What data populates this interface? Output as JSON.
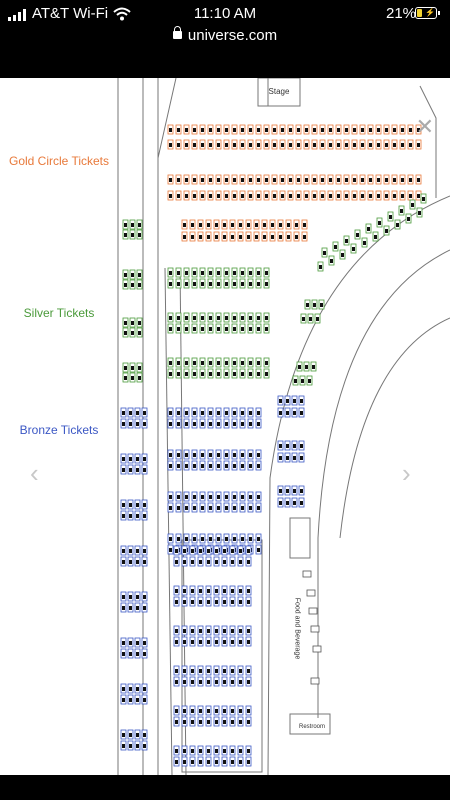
{
  "status_bar": {
    "carrier": "AT&T Wi-Fi",
    "time": "11:10 AM",
    "battery": "21%"
  },
  "browser": {
    "url": "universe.com"
  },
  "map": {
    "stage_label": "Stage",
    "food_label": "Food and Beverage",
    "restroom_label": "Restroom",
    "legend": {
      "gold": {
        "label": "Gold Circle Tickets",
        "color": "#e8793a"
      },
      "silver": {
        "label": "Silver Tickets",
        "color": "#4a9a3a"
      },
      "bronze": {
        "label": "Bronze Tickets",
        "color": "#3b57c4"
      }
    }
  },
  "viewer": {
    "close_icon": "close-icon",
    "prev_icon": "chevron-left-icon",
    "next_icon": "chevron-right-icon"
  }
}
